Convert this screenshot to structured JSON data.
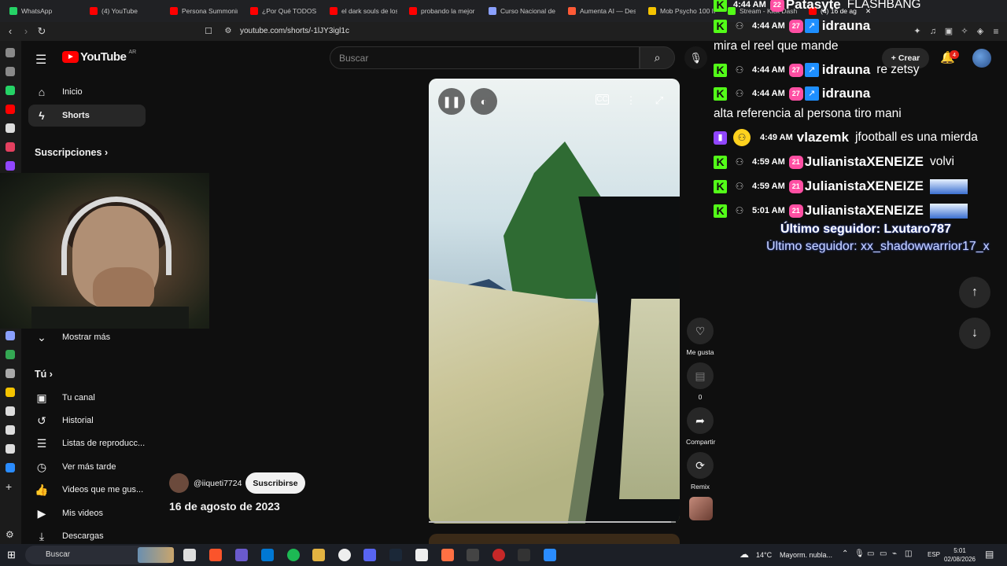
{
  "browser": {
    "tabs": [
      {
        "label": "WhatsApp",
        "color": "#25d366"
      },
      {
        "label": "(4) YouTube",
        "color": "#ff0000"
      },
      {
        "label": "Persona Summonin",
        "color": "#ff0000"
      },
      {
        "label": "¿Por Qué TODOS O",
        "color": "#ff0000"
      },
      {
        "label": "el dark souls de los",
        "color": "#ff0000"
      },
      {
        "label": "probando la mejor",
        "color": "#ff0000"
      },
      {
        "label": "Curso Nacional de",
        "color": "#8aa0ff"
      },
      {
        "label": "Aumenta AI — Des",
        "color": "#ff5a36"
      },
      {
        "label": "Mob Psycho 100 II",
        "color": "#f5c400"
      },
      {
        "label": "Stream - Kick Dash",
        "color": "#53fc18"
      },
      {
        "label": "(4) 16 de ag",
        "color": "#ff0000"
      }
    ],
    "url": "youtube.com/shorts/-1lJY3igl1c"
  },
  "youtube": {
    "logo_text": "YouTube",
    "country_code": "AR",
    "search_placeholder": "Buscar",
    "create_label": "Crear",
    "notification_count": "4",
    "sidebar": {
      "items_top": [
        {
          "label": "Inicio",
          "icon": "home-icon"
        },
        {
          "label": "Shorts",
          "icon": "shorts-icon"
        }
      ],
      "subscriptions_heading": "Suscripciones",
      "show_more": "Mostrar más",
      "you_heading": "Tú",
      "you_items": [
        {
          "label": "Tu canal",
          "icon": "user-box-icon"
        },
        {
          "label": "Historial",
          "icon": "history-icon"
        },
        {
          "label": "Listas de reproducc...",
          "icon": "playlist-icon"
        },
        {
          "label": "Ver más tarde",
          "icon": "clock-icon"
        },
        {
          "label": "Videos que me gus...",
          "icon": "like-icon"
        },
        {
          "label": "Mis videos",
          "icon": "video-icon"
        },
        {
          "label": "Descargas",
          "icon": "download-icon"
        }
      ]
    },
    "short": {
      "channel": "@iiqueti7724",
      "subscribe_label": "Suscribirse",
      "date": "16 de agosto de 2023",
      "progress": 0.98
    },
    "actions": {
      "like": "Me gusta",
      "comments": "0",
      "share": "Compartir",
      "remix": "Remix"
    }
  },
  "chat": {
    "top_partial": {
      "time": "4:44 AM",
      "badge": "22",
      "user": "Patasyte",
      "msg": "FLASHBANG"
    },
    "messages": [
      {
        "platform": "kick",
        "time": "4:44 AM",
        "badge": "27",
        "user": "idrauna",
        "msg": ""
      },
      {
        "platform": "kick",
        "time": "4:44 AM",
        "badge": "27",
        "user": "idrauna",
        "msg": "re zetsy"
      },
      {
        "platform": "kick",
        "time": "4:44 AM",
        "badge": "27",
        "user": "idrauna",
        "msg": ""
      },
      {
        "platform": "twitch",
        "time": "4:49 AM",
        "badge": "",
        "user": "vlazemk",
        "msg": "jfootball es una mierda"
      },
      {
        "platform": "kick",
        "time": "4:59 AM",
        "badge": "21",
        "user": "JulianistaXENEIZE",
        "msg": "volvi"
      },
      {
        "platform": "kick",
        "time": "4:59 AM",
        "badge": "21",
        "user": "JulianistaXENEIZE",
        "msg": ""
      },
      {
        "platform": "kick",
        "time": "5:01 AM",
        "badge": "21",
        "user": "JulianistaXENEIZE",
        "msg": ""
      }
    ],
    "line_1": "mira el reel que mande",
    "line_2": "alta referencia al persona tiro mani",
    "follower_1": "Último seguidor: Lxutaro787",
    "follower_2": "Último seguidor: xx_shadowwarrior17_x"
  },
  "taskbar": {
    "search_label": "Buscar",
    "weather": "14°C",
    "weather_desc": "Mayorm. nubla...",
    "lang": "ESP",
    "time": "5:01",
    "date": "02/08/2026"
  }
}
